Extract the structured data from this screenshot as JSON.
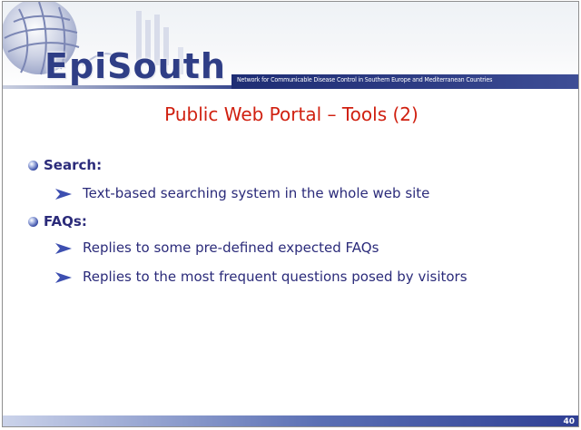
{
  "header": {
    "logo_text": "EpiSouth",
    "tagline": "Network for Communicable Disease Control in Southern Europe and Mediterranean Countries"
  },
  "slide": {
    "title": "Public Web Portal – Tools (2)",
    "bullets": [
      {
        "label": "Search:",
        "subs": [
          "Text-based searching system in the whole web site"
        ]
      },
      {
        "label": "FAQs:",
        "subs": [
          "Replies to some pre-defined expected FAQs",
          "Replies to the most frequent questions posed by visitors"
        ]
      }
    ],
    "page_number": "40"
  },
  "colors": {
    "title": "#d02010",
    "text": "#2b2b7a",
    "brand": "#2f3e86"
  },
  "icons": [
    "globe-logo-icon",
    "round-bullet-icon",
    "arrow-bullet-icon"
  ]
}
